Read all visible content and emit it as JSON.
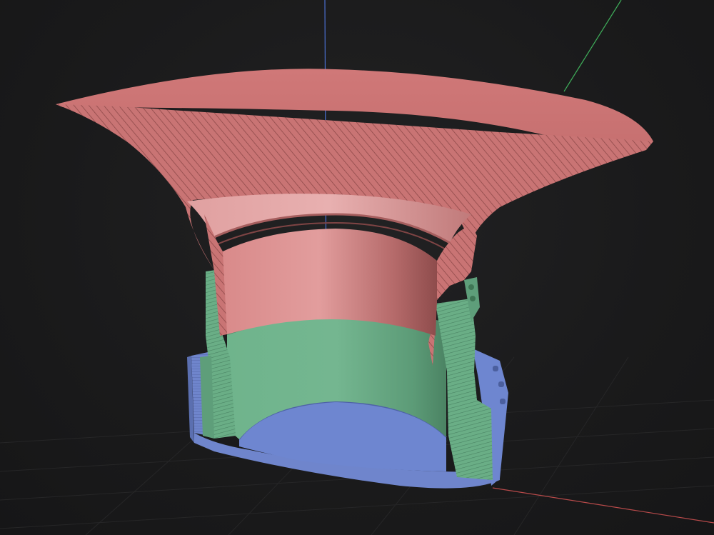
{
  "viewport": {
    "background": "#1b1b1c",
    "grid_color": "#2a2a2b",
    "axes": {
      "x_color": "#b84a4a",
      "y_color": "#3fae5a",
      "z_color": "#4a6fd0"
    }
  },
  "model": {
    "parts": [
      {
        "name": "flared-horn",
        "color": "#d47c7c"
      },
      {
        "name": "inner-sleeve",
        "color": "#68ad86"
      },
      {
        "name": "base-cup",
        "color": "#6e86d0"
      }
    ],
    "section_view": true,
    "section_hatch": true
  }
}
